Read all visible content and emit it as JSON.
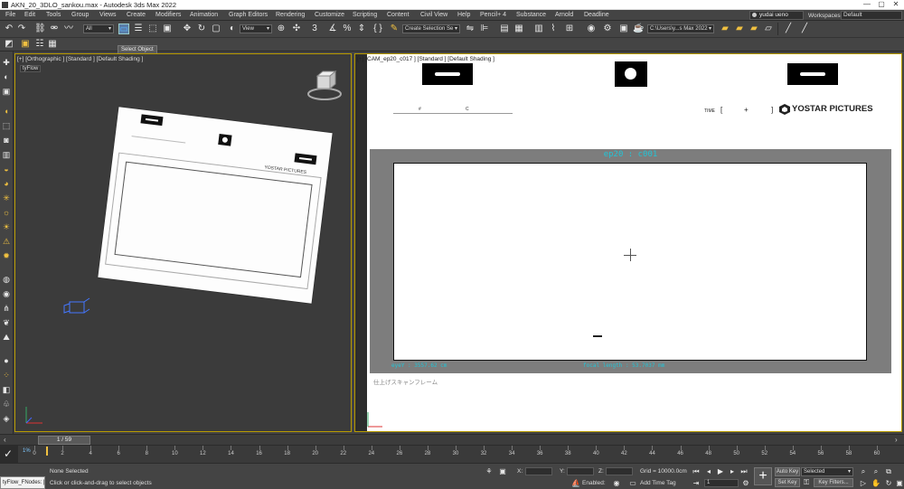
{
  "window": {
    "title": "AKN_20_3DLO_sankou.max - Autodesk 3ds Max 2022",
    "buttons": [
      "—",
      "▢",
      "✕"
    ]
  },
  "menu": [
    "File",
    "Edit",
    "Tools",
    "Group",
    "Views",
    "Create",
    "Modifiers",
    "Animation",
    "Graph Editors",
    "Rendering",
    "Customize",
    "Scripting",
    "Content",
    "Civil View",
    "Help",
    "Pencil+ 4",
    "Substance",
    "Arnold",
    "Deadline"
  ],
  "user": {
    "name": "yudai ueno",
    "workspaces_label": "Workspaces:",
    "workspace": "Default"
  },
  "toolbar": {
    "filter": "All",
    "view": "View",
    "selection_set": "Create Selection Se",
    "project_path": "C:\\Users\\y...s Max 2022",
    "tooltip": "Select Object"
  },
  "viewport_left": {
    "label": "[+] [Orthographic ] [Standard ] [Default Shading ]",
    "tyflow": "tyFlow",
    "board_brand": "YOSTAR PICTURES"
  },
  "viewport_right": {
    "label": "[+] [CAM_ep20_c017 ] [Standard ] [Default Shading ]",
    "time_label": "TIME",
    "time_open": "[",
    "time_plus": "+",
    "time_close": "]",
    "brand": "YOSTAR PICTURES",
    "field_a": "#",
    "field_b": "C",
    "cut_title": "ep20 : c001",
    "eye_value": "eyeY : 3557.62 cm",
    "focal_length": "focal length : 53.7037 mm",
    "frame_caption": "仕上げスキャンフレーム"
  },
  "timeline": {
    "frame_display": "1 / 59",
    "ticks": [
      "0",
      "2",
      "4",
      "6",
      "8",
      "10",
      "12",
      "14",
      "16",
      "18",
      "20",
      "22",
      "24",
      "26",
      "28",
      "30",
      "32",
      "34",
      "36",
      "38",
      "40",
      "42",
      "44",
      "46",
      "48",
      "50",
      "52",
      "54",
      "56",
      "58",
      "60"
    ],
    "track_start": "1%"
  },
  "status": {
    "listener": "tyFlow_FNodes: [f",
    "selection": "None Selected",
    "prompt": "Click or click-and-drag to select objects",
    "x_label": "X:",
    "y_label": "Y:",
    "z_label": "Z:",
    "grid": "Grid = 10000.0cm",
    "enabled_label": "Enabled:",
    "add_time_tag": "Add Time Tag",
    "auto_key": "Auto Key",
    "set_key": "Set Key",
    "selected_dropdown": "Selected",
    "key_filters": "Key Filters...",
    "current_frame": "1"
  },
  "colors": {
    "accent_yellow": "#b89b00",
    "cyan_text": "#22c4d6",
    "viewport_dark": "#3b3b3b",
    "frame_gray": "#7d7d7d"
  }
}
